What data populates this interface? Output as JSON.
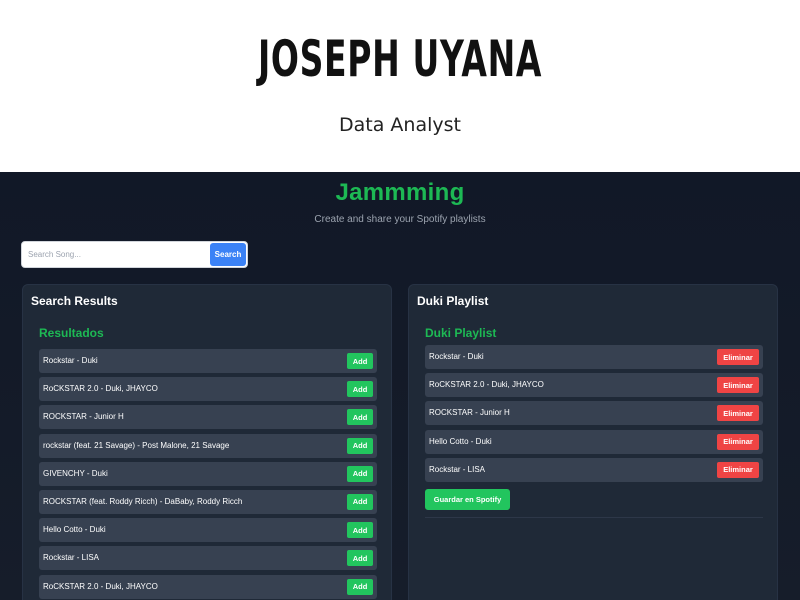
{
  "hero": {
    "name": "JOSEPH UYANA",
    "role": "Data Analyst"
  },
  "app": {
    "title": "Jammming",
    "subtitle": "Create and share your Spotify playlists"
  },
  "search": {
    "placeholder": "Search Song...",
    "button_label": "Search"
  },
  "results": {
    "heading": "Search Results",
    "subheading": "Resultados",
    "add_label": "Add",
    "tracks": [
      "Rockstar - Duki",
      "RoCKSTAR 2.0 - Duki, JHAYCO",
      "ROCKSTAR - Junior H",
      "rockstar (feat. 21 Savage) - Post Malone, 21 Savage",
      "GIVENCHY - Duki",
      "ROCKSTAR (feat. Roddy Ricch) - DaBaby, Roddy Ricch",
      "Hello Cotto - Duki",
      "Rockstar - LISA",
      "RoCKSTAR 2.0 - Duki, JHAYCO"
    ]
  },
  "playlist": {
    "heading": "Duki Playlist",
    "subheading": "Duki Playlist",
    "remove_label": "Eliminar",
    "save_label": "Guardar en Spotify",
    "tracks": [
      "Rockstar - Duki",
      "RoCKSTAR 2.0 - Duki, JHAYCO",
      "ROCKSTAR - Junior H",
      "Hello Cotto - Duki",
      "Rockstar - LISA"
    ]
  },
  "colors": {
    "accent": "#1db954",
    "add_button": "#22c55e",
    "remove_button": "#ef4444",
    "search_button": "#3b82f6",
    "panel": "#1f2937",
    "track_row": "#374151"
  }
}
